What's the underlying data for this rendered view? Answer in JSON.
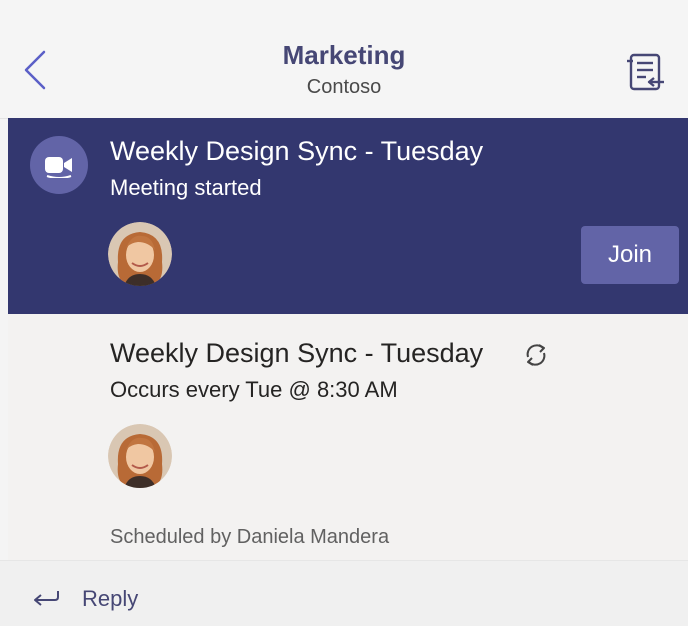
{
  "header": {
    "title": "Marketing",
    "subtitle": "Contoso",
    "back_icon": "chevron-left-icon",
    "right_icon": "conversation-list-icon"
  },
  "meeting_banner": {
    "title": "Weekly Design Sync - Tuesday",
    "status": "Meeting started",
    "join_label": "Join",
    "icon": "video-camera-icon",
    "background_color": "#33376f",
    "accent_color": "#6264a7"
  },
  "meeting_card": {
    "title": "Weekly Design Sync - Tuesday",
    "recurrence": "Occurs every Tue @ 8:30 AM",
    "scheduled_by": "Scheduled by Daniela Mandera",
    "icon": "repeat-icon"
  },
  "reply": {
    "label": "Reply",
    "icon": "reply-arrow-icon"
  }
}
